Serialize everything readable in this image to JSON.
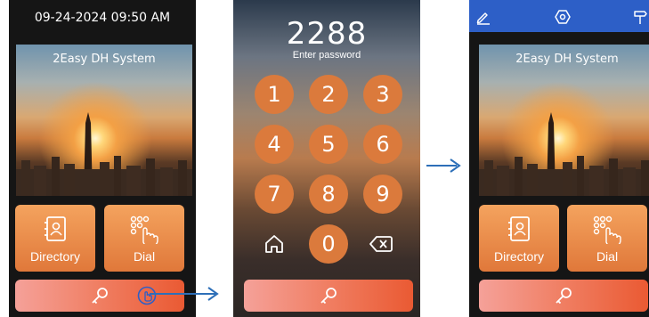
{
  "screen1": {
    "datetime": "09-24-2024 09:50 AM",
    "banner_title": "2Easy DH System",
    "tiles": [
      {
        "label": "Directory",
        "icon": "contact-book-icon"
      },
      {
        "label": "Dial",
        "icon": "dial-pad-icon"
      }
    ],
    "unlock_icon": "key-icon"
  },
  "screen2": {
    "password_value": "2288",
    "password_hint": "Enter password",
    "keys": [
      "1",
      "2",
      "3",
      "4",
      "5",
      "6",
      "7",
      "8",
      "9",
      "0"
    ],
    "home_icon": "home-icon",
    "backspace_icon": "backspace-icon",
    "unlock_icon": "key-icon"
  },
  "screen3": {
    "toolbar_icons": [
      "edit-icon",
      "settings-icon",
      "signpost-icon"
    ],
    "banner_title": "2Easy DH System",
    "tiles": [
      {
        "label": "Directory",
        "icon": "contact-book-icon"
      },
      {
        "label": "Dial",
        "icon": "dial-pad-icon"
      }
    ],
    "unlock_icon": "key-icon"
  },
  "colors": {
    "accent_orange": "#e0783a",
    "toolbar_blue": "#2d5fc7",
    "arrow_blue": "#2d6fb8"
  }
}
